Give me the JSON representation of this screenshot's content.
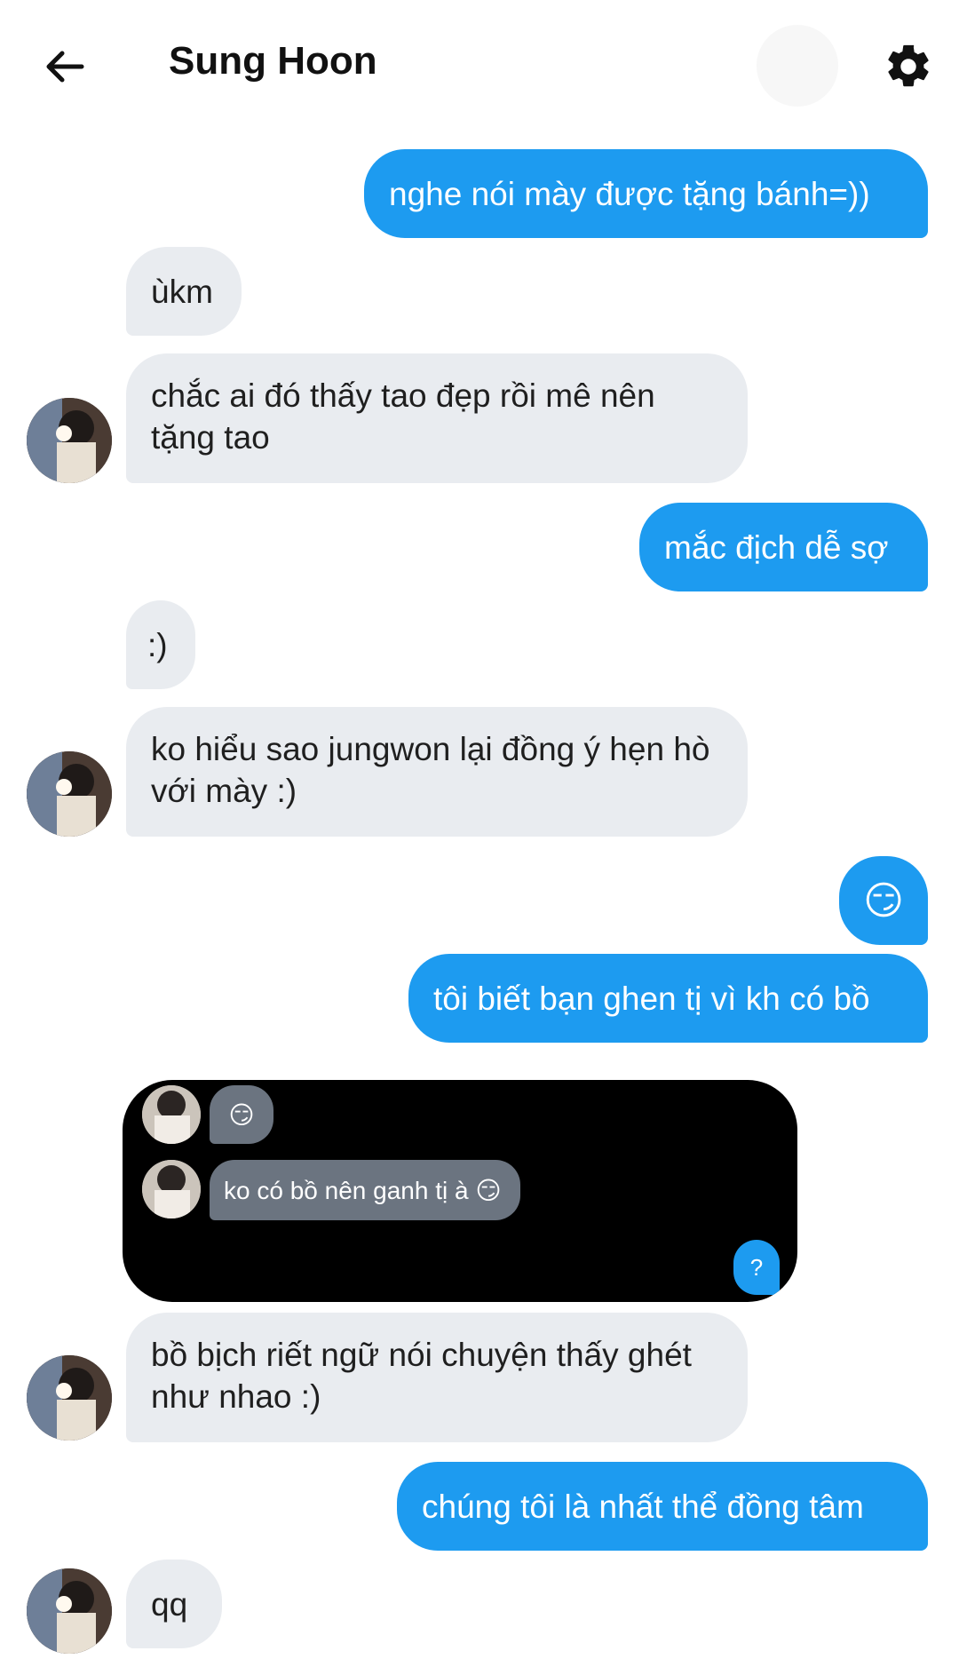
{
  "header": {
    "title": "Sung Hoon",
    "back_icon": "arrow-left-icon",
    "settings_icon": "gear-icon"
  },
  "messages": [
    {
      "side": "out",
      "text": "nghe nói mày được tặng bánh=))"
    },
    {
      "side": "in",
      "text": "ùkm"
    },
    {
      "side": "in",
      "text": "chắc ai đó thấy tao đẹp rồi mê nên tặng tao"
    },
    {
      "side": "out",
      "text": "mắc địch dễ sợ"
    },
    {
      "side": "in",
      "text": ":)"
    },
    {
      "side": "in",
      "text": "ko hiểu sao jungwon lại đồng ý hẹn hò với mày :)"
    },
    {
      "side": "out",
      "text": "😏"
    },
    {
      "side": "out",
      "text": "tôi biết bạn ghen tị vì kh có bồ"
    },
    {
      "side": "in",
      "text": "bồ bịch riết ngữ nói chuyện thấy ghét như nhao :)"
    },
    {
      "side": "out",
      "text": "chúng tôi là nhất thể đồng tâm"
    },
    {
      "side": "in",
      "text": "qq"
    }
  ],
  "embedded_screenshot": {
    "messages": [
      {
        "side": "in",
        "text": "😏"
      },
      {
        "side": "in",
        "text": "ko có bồ nên ganh tị à 😏"
      },
      {
        "side": "out",
        "text": "?"
      }
    ]
  },
  "colors": {
    "outgoing": "#1d9bf0",
    "incoming": "#e9ecf0",
    "embed_background": "#000000",
    "embed_incoming": "#6b7480"
  }
}
